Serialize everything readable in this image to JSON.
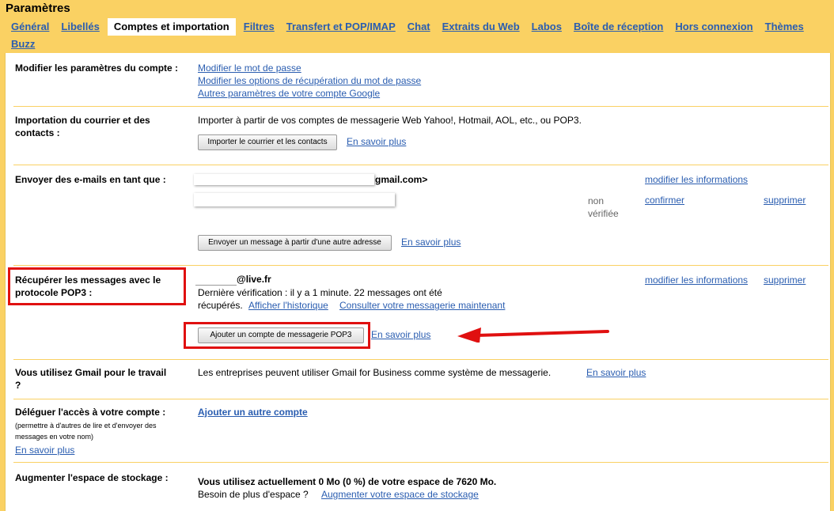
{
  "header": {
    "title": "Paramètres"
  },
  "tabs": [
    {
      "label": "Général",
      "active": false
    },
    {
      "label": "Libellés",
      "active": false
    },
    {
      "label": "Comptes et importation",
      "active": true
    },
    {
      "label": "Filtres",
      "active": false
    },
    {
      "label": "Transfert et POP/IMAP",
      "active": false
    },
    {
      "label": "Chat",
      "active": false
    },
    {
      "label": "Extraits du Web",
      "active": false
    },
    {
      "label": "Labos",
      "active": false
    },
    {
      "label": "Boîte de réception",
      "active": false
    },
    {
      "label": "Hors connexion",
      "active": false
    },
    {
      "label": "Thèmes",
      "active": false
    },
    {
      "label": "Buzz",
      "active": false
    }
  ],
  "sections": {
    "account": {
      "label": "Modifier les paramètres du compte :",
      "links": [
        "Modifier le mot de passe",
        "Modifier les options de récupération du mot de passe",
        "Autres paramètres de votre compte Google"
      ]
    },
    "import": {
      "label": "Importation du courrier et des contacts :",
      "desc": "Importer à partir de vos comptes de messagerie Web Yahoo!, Hotmail, AOL, etc., ou POP3.",
      "button": "Importer le courrier et les contacts",
      "learn": "En savoir plus"
    },
    "sendas": {
      "label": "Envoyer des e-mails en tant que :",
      "address1_suffix": "gmail.com>",
      "edit1": "modifier les informations",
      "status2_line1": "non",
      "status2_line2": "vérifiée",
      "confirm2": "confirmer",
      "delete2": "supprimer",
      "button": "Envoyer un message à partir d'une autre adresse",
      "learn": "En savoir plus"
    },
    "pop3": {
      "label": "Récupérer les messages avec le protocole POP3 :",
      "account_suffix": "@live.fr",
      "check_line1": "Dernière vérification : il y a 1 minute. 22 messages ont été",
      "check_line2": "récupérés.",
      "history": "Afficher l'historique",
      "check_now": "Consulter votre messagerie maintenant",
      "edit": "modifier les informations",
      "delete": "supprimer",
      "button": "Ajouter un compte de messagerie POP3",
      "learn": "En savoir plus"
    },
    "work": {
      "label": "Vous utilisez Gmail pour le travail ?",
      "desc": "Les entreprises peuvent utiliser Gmail for Business comme système de messagerie.",
      "learn": "En savoir plus"
    },
    "delegate": {
      "label": "Déléguer l'accès à votre compte :",
      "note": "(permettre à d'autres de lire et d'envoyer des messages en votre nom)",
      "learn": "En savoir plus",
      "add": "Ajouter un autre compte"
    },
    "storage": {
      "label": "Augmenter l'espace de stockage :",
      "usage": "Vous utilisez actuellement 0 Mo (0 %) de votre espace de 7620 Mo.",
      "more": "Besoin de plus d'espace ?",
      "link": "Augmenter votre espace de stockage"
    }
  },
  "colors": {
    "accent": "#fad163",
    "link": "#2a5db0",
    "annotation": "#e01010"
  }
}
